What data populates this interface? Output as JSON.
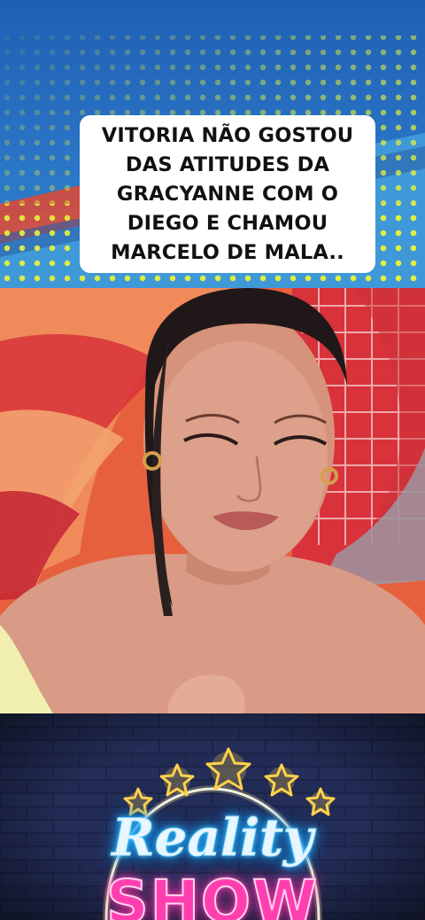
{
  "caption": {
    "text": "VITORIA NÃO GOSTOU\nDAS ATITUDES DA\nGRACYANNE  COM O\nDIEGO E CHAMOU\nMARCELO DE MALA.."
  },
  "video": {
    "subject": "video-frame"
  },
  "logo": {
    "line1": "Reality",
    "line2": "SHOW",
    "star_count": 5
  },
  "colors": {
    "banner_blue": "#2a74c6",
    "dot_yellow": "#e6f23a",
    "neon_blue": "#39c8ff",
    "neon_pink": "#ff3fb0",
    "star_gold": "#ffd24a"
  }
}
